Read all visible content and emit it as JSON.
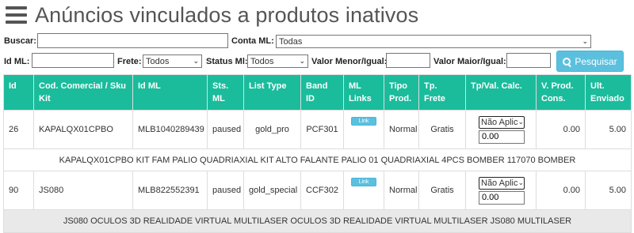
{
  "header": {
    "title": "Anúncios vinculados a produtos inativos",
    "menu_icon": "hamburger-icon"
  },
  "filters": {
    "buscar_label": "Buscar:",
    "buscar_value": "",
    "conta_label": "Conta ML:",
    "conta_value": "Todas",
    "idml_label": "Id ML:",
    "idml_value": "",
    "frete_label": "Frete:",
    "frete_value": "Todos",
    "status_label": "Status Ml:",
    "status_value": "Todos",
    "valor_menor_label": "Valor Menor/Igual:",
    "valor_menor_value": "",
    "valor_maior_label": "Valor Maior/Igual:",
    "valor_maior_value": "",
    "search_button": "Pesquisar"
  },
  "table": {
    "headers": [
      "Id",
      "Cod. Comercial / Sku Kit",
      "Id ML",
      "Sts. ML",
      "List Type",
      "Band ID",
      "ML Links",
      "Tipo Prod.",
      "Tp. Frete",
      "Tp/Val. Calc.",
      "V. Prod. Cons.",
      "Ult. Enviado"
    ],
    "rows": [
      {
        "id": "26",
        "sku": "KAPALQX01CPBO",
        "idml": "MLB1040289439",
        "status": "paused",
        "list_type": "gold_pro",
        "band_id": "PCF301",
        "link": "Link",
        "tipo": "Normal",
        "frete": "Gratis",
        "calc_select": "Não Aplic",
        "calc_value": "0.00",
        "v_prod": "0.00",
        "ult": "5.00",
        "description": "KAPALQX01CPBO KIT FAM PALIO QUADRIAXIAL KIT ALTO FALANTE PALIO 01 QUADRIAXIAL 4PCS BOMBER 117070 BOMBER"
      },
      {
        "id": "90",
        "sku": "JS080",
        "idml": "MLB822552391",
        "status": "paused",
        "list_type": "gold_special",
        "band_id": "CCF302",
        "link": "Link",
        "tipo": "Normal",
        "frete": "Gratis",
        "calc_select": "Não Aplic",
        "calc_value": "0.00",
        "v_prod": "0.00",
        "ult": "5.00",
        "description": "JS080 OCULOS 3D REALIDADE VIRTUAL MULTILASER OCULOS 3D REALIDADE VIRTUAL MULTILASER JS080 MULTILASER"
      }
    ]
  },
  "colors": {
    "header_bg": "#1abc9c",
    "button_bg": "#5bc0de",
    "row_alt": "#e9e9e9"
  }
}
